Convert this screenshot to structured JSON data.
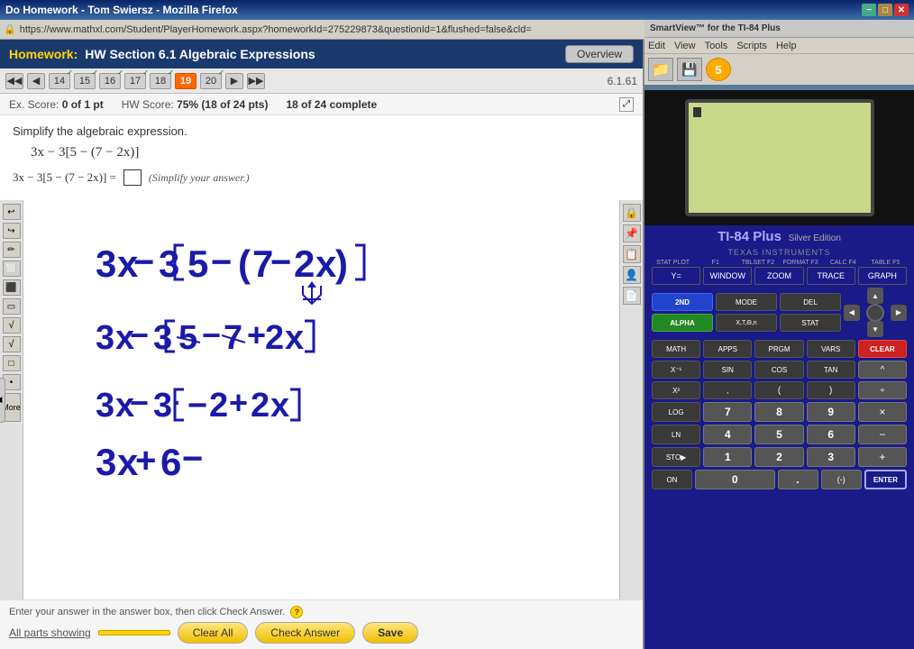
{
  "browser": {
    "title": "Do Homework - Tom Swiersz - Mozilla Firefox",
    "url": "https://www.mathxl.com/Student/PlayerHomework.aspx?homeworkId=275229873&questionId=1&flushed=false&cld=",
    "minimize": "−",
    "maximize": "□",
    "close": "✕"
  },
  "smartview": {
    "label": "SmartView™ for the TI-84 Plus",
    "menu": [
      "Edit",
      "View",
      "Tools",
      "Scripts",
      "Help"
    ]
  },
  "homework": {
    "label": "Homework:",
    "title": "HW Section 6.1 Algebraic Expressions",
    "overview_btn": "Overview",
    "question_id": "6.1.61",
    "nav": {
      "prev_skip": "◀◀",
      "prev": "◀",
      "next": "▶",
      "next_skip": "▶▶",
      "numbers": [
        "14",
        "15",
        "16",
        "17",
        "18",
        "19",
        "20"
      ],
      "active": "19",
      "completed_checks": [
        "14",
        "15",
        "16",
        "17",
        "18",
        "20"
      ]
    },
    "scores": {
      "ex_label": "Ex. Score:",
      "ex_value": "0 of 1 pt",
      "hw_label": "HW Score:",
      "hw_value": "75% (18 of 24 pts)",
      "progress_label": "18 of 24 complete"
    },
    "question": {
      "text": "Simplify the algebraic expression.",
      "expression": "3x − 3[5 − (7 − 2x)]",
      "answer_prefix": "3x − 3[5 − (7 − 2x)] =",
      "answer_hint": "(Simplify your answer.)"
    },
    "footer": {
      "hint": "Enter your answer in the answer box, then click Check Answer.",
      "parts_label": "All parts showing",
      "clear_all": "Clear All",
      "check_answer": "Check Answer",
      "save": "Save"
    }
  },
  "toolbar": {
    "left_tools": [
      "↩",
      "↪",
      "▲",
      "▼",
      "□",
      "□",
      "√",
      "√",
      "□",
      "•",
      "…"
    ],
    "right_tools": [
      "🔒",
      "📌",
      "📋",
      "👤",
      "📄"
    ]
  },
  "calculator": {
    "brand_ti": "TI-84 Plus",
    "brand_sub": "Silver Edition",
    "brand_texas": "TEXAS INSTRUMENTS",
    "func_keys": [
      "STAT PLOT",
      "F1",
      "TBLSET F2",
      "FORMAT F3",
      "CALC F4",
      "TABLE F5"
    ],
    "top_row": [
      "Y=",
      "WINDOW",
      "ZOOM",
      "TRACE",
      "GRAPH"
    ],
    "second_row_labels": [
      "2ND",
      "MODE",
      "DEL"
    ],
    "alpha_row_labels": [
      "ALPHA",
      "X,T,Θ,n",
      "STAT"
    ],
    "math_row": [
      "MATH",
      "APPS",
      "PRGM",
      "VARS",
      "CLEAR"
    ],
    "trig_row": [
      "X⁻¹",
      "SIN",
      "COS",
      "TAN",
      "^"
    ],
    "sq_row": [
      "X²",
      ",",
      "(",
      ")",
      "÷"
    ],
    "log_row": [
      "LOG",
      "7",
      "8",
      "9",
      "×"
    ],
    "ln_row": [
      "LN",
      "4",
      "5",
      "6",
      "-"
    ],
    "sto_row": [
      "STO▶",
      "1",
      "2",
      "3",
      "+"
    ],
    "on_row": [
      "ON",
      "0",
      ".",
      "(-)",
      "ENTER"
    ]
  }
}
